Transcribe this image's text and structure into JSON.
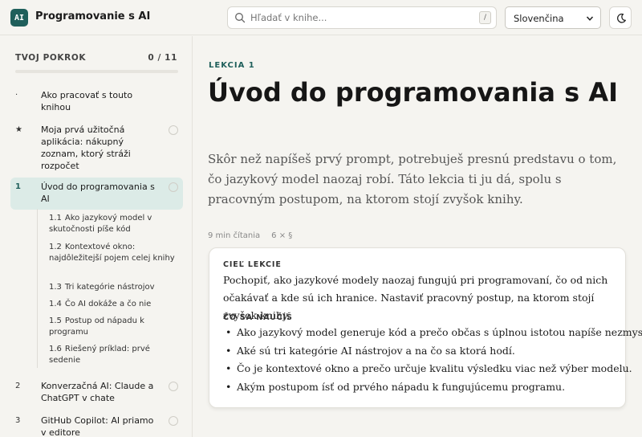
{
  "header": {
    "logo_text": "AI",
    "title": "Programovanie s AI",
    "search": {
      "placeholder": "Hľadať v knihe...",
      "shortcut": "/"
    },
    "language": {
      "selected": "Slovenčina"
    },
    "theme_toggle_icon": "moon-icon"
  },
  "sidebar": {
    "progress": {
      "label": "TVOJ POKROK",
      "count": "0 / 11",
      "fraction": 0
    },
    "items": [
      {
        "num": "·",
        "title": "Ako pracovať s touto knihou"
      },
      {
        "num": "★",
        "title": "Moja prvá užitočná aplikácia: nákupný zoznam, ktorý stráži rozpočet"
      },
      {
        "num": "1",
        "title": "Úvod do programovania s AI"
      },
      {
        "num": "2",
        "title": "Konverzačná AI: Claude a ChatGPT v chate"
      },
      {
        "num": "3",
        "title": "GitHub Copilot: AI priamo v editore"
      }
    ],
    "subitems": [
      {
        "num": "1.1",
        "title": "Ako jazykový model v skutočnosti píše kód"
      },
      {
        "num": "1.2",
        "title": "Kontextové okno: najdôležitejší pojem celej knihy"
      },
      {
        "num": "1.3",
        "title": "Tri kategórie nástrojov"
      },
      {
        "num": "1.4",
        "title": "Čo AI dokáže a čo nie"
      },
      {
        "num": "1.5",
        "title": "Postup od nápadu k programu"
      },
      {
        "num": "1.6",
        "title": "Riešený príklad: prvé sedenie"
      }
    ]
  },
  "main": {
    "eyebrow": "LEKCIA 1",
    "title": "Úvod do programovania s AI",
    "lead": "Skôr než napíšeš prvý prompt, potrebuješ presnú predstavu o tom, čo jazykový model naozaj robí. Táto lekcia ti ju dá, spolu s pracovným postupom, na ktorom stojí zvyšok knihy.",
    "meta": {
      "read_time": "9 min čítania",
      "sections": "6 × §"
    },
    "card": {
      "goal_heading": "CIEĽ LEKCIE",
      "goal_text": "Pochopiť, ako jazykové modely naozaj fungujú pri programovaní, čo od nich očakávať a kde sú ich hranice. Nastaviť pracovný postup, na ktorom stojí zvyšok knihy.",
      "learn_heading": "ČO SA NAUČÍŠ",
      "learn_items": [
        "Ako jazykový model generuje kód a prečo občas s úplnou istotou napíše nezmysel.",
        "Aké sú tri kategórie AI nástrojov a na čo sa ktorá hodí.",
        "Čo je kontextové okno a prečo určuje kvalitu výsledku viac než výber modelu.",
        "Akým postupom ísť od prvého nápadu k fungujúcemu programu."
      ]
    }
  },
  "colors": {
    "accent": "#1f5f5b",
    "active_bg": "#dcebe7",
    "page_bg": "#f5f4f0"
  }
}
